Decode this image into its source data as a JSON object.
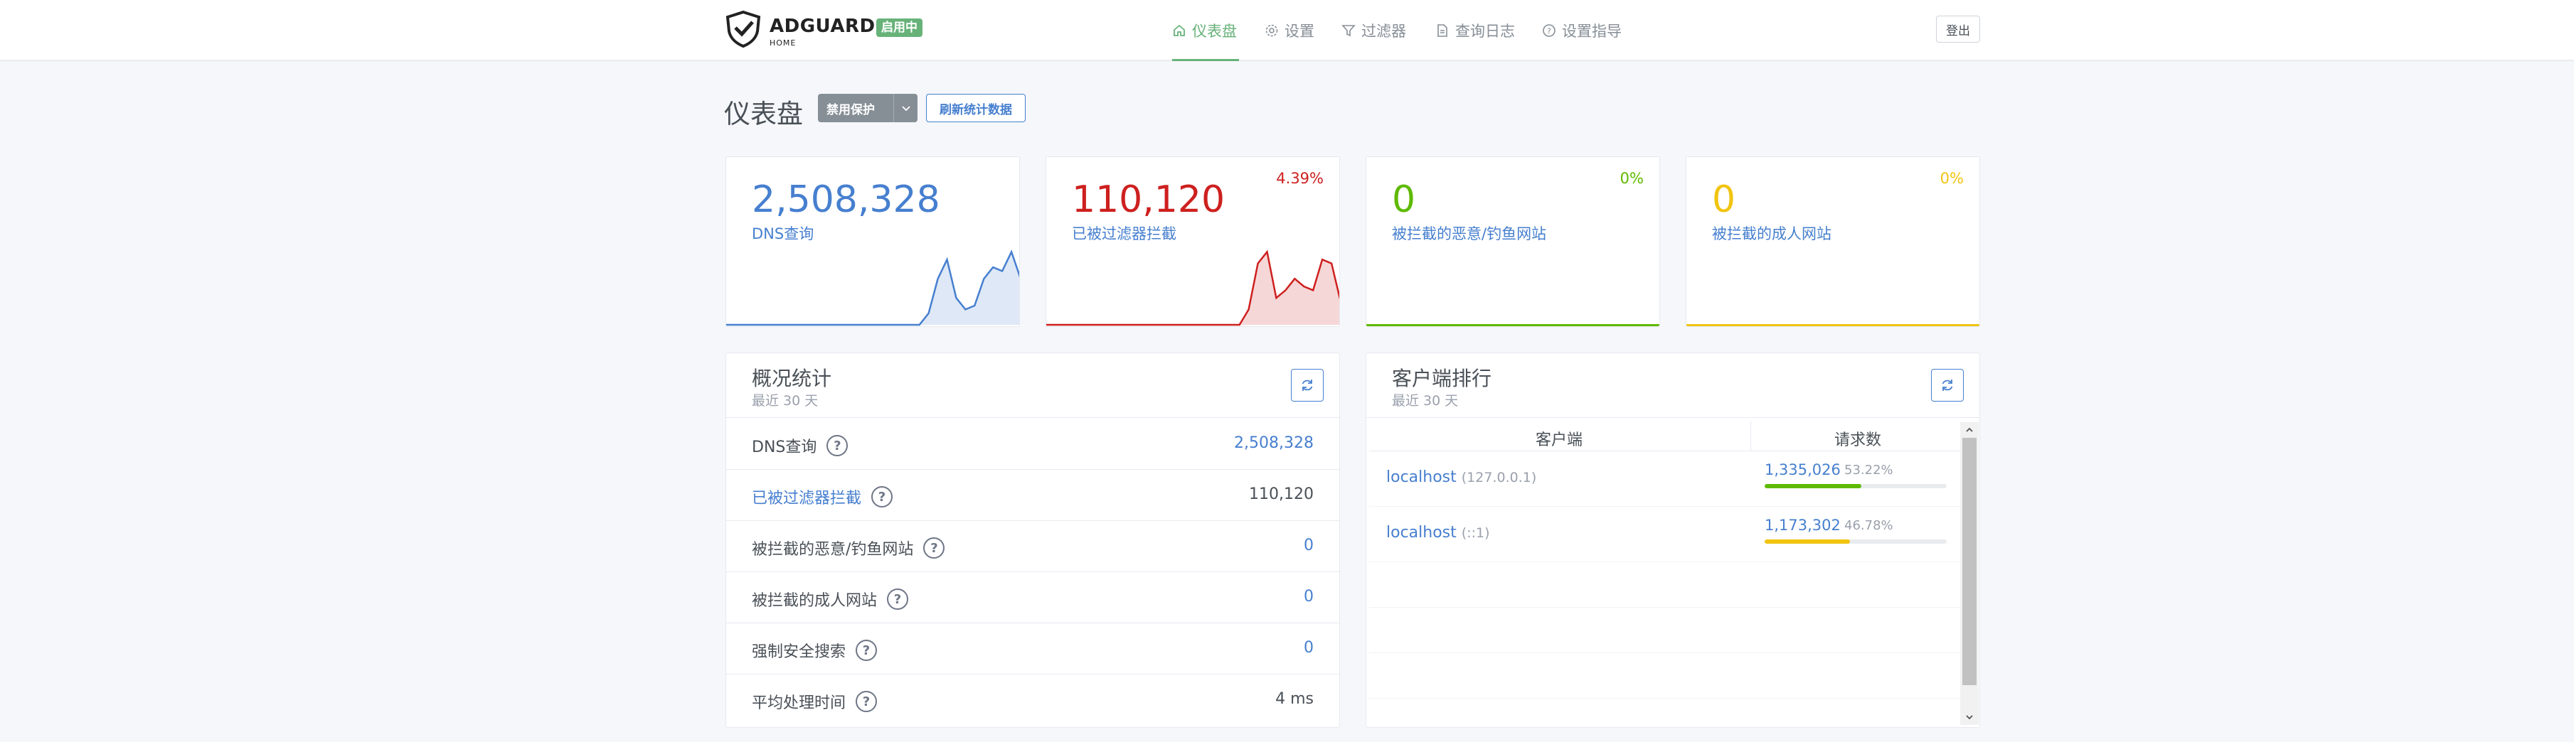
{
  "header": {
    "brand": "ADGUARD",
    "brand_sub": "HOME",
    "status_badge": "启用中",
    "nav": [
      {
        "label": "仪表盘",
        "icon": "home-icon",
        "active": true
      },
      {
        "label": "设置",
        "icon": "gear-icon",
        "active": false
      },
      {
        "label": "过滤器",
        "icon": "filter-icon",
        "active": false
      },
      {
        "label": "查询日志",
        "icon": "log-icon",
        "active": false
      },
      {
        "label": "设置指导",
        "icon": "help-circle-icon",
        "active": false
      }
    ],
    "logout": "登出"
  },
  "page": {
    "title": "仪表盘",
    "disable_protection": "禁用保护",
    "refresh_stats": "刷新统计数据"
  },
  "cards": [
    {
      "value": "2,508,328",
      "label": "DNS查询",
      "percent": "",
      "color": "#467fcf"
    },
    {
      "value": "110,120",
      "label": "已被过滤器拦截",
      "percent": "4.39%",
      "color": "#cd201f"
    },
    {
      "value": "0",
      "label": "被拦截的恶意/钓鱼网站",
      "percent": "0%",
      "color": "#5eba00"
    },
    {
      "value": "0",
      "label": "被拦截的成人网站",
      "percent": "0%",
      "color": "#f1c40f"
    }
  ],
  "overview": {
    "title": "概况统计",
    "subtitle": "最近 30 天",
    "rows": [
      {
        "label": "DNS查询",
        "value": "2,508,328",
        "link": false
      },
      {
        "label": "已被过滤器拦截",
        "value": "110,120",
        "link": true
      },
      {
        "label": "被拦截的恶意/钓鱼网站",
        "value": "0",
        "link": false
      },
      {
        "label": "被拦截的成人网站",
        "value": "0",
        "link": false
      },
      {
        "label": "强制安全搜索",
        "value": "0",
        "link": false
      },
      {
        "label": "平均处理时间",
        "value": "4 ms",
        "link": false
      }
    ]
  },
  "clients": {
    "title": "客户端排行",
    "subtitle": "最近 30 天",
    "col_client": "客户端",
    "col_requests": "请求数",
    "rows": [
      {
        "name": "localhost",
        "ip": "(127.0.0.1)",
        "count": "1,335,026",
        "percent": "53.22%",
        "fraction": 0.5322,
        "color": "#5eba00"
      },
      {
        "name": "localhost",
        "ip": "(::1)",
        "count": "1,173,302",
        "percent": "46.78%",
        "fraction": 0.4678,
        "color": "#f1c40f"
      }
    ]
  },
  "sparklines": {
    "dns": [
      0,
      0,
      0,
      0,
      0,
      0,
      0,
      0,
      0,
      0,
      0,
      0,
      0,
      0,
      0,
      0,
      0,
      0,
      0,
      0,
      0,
      0,
      0.15,
      0.6,
      0.85,
      0.35,
      0.2,
      0.25,
      0.6,
      0.75,
      0.7,
      0.95,
      0.6
    ],
    "blocked": [
      0,
      0,
      0,
      0,
      0,
      0,
      0,
      0,
      0,
      0,
      0,
      0,
      0,
      0,
      0,
      0,
      0,
      0,
      0,
      0,
      0,
      0,
      0.2,
      0.8,
      0.95,
      0.35,
      0.45,
      0.6,
      0.5,
      0.45,
      0.85,
      0.8,
      0.3
    ]
  }
}
